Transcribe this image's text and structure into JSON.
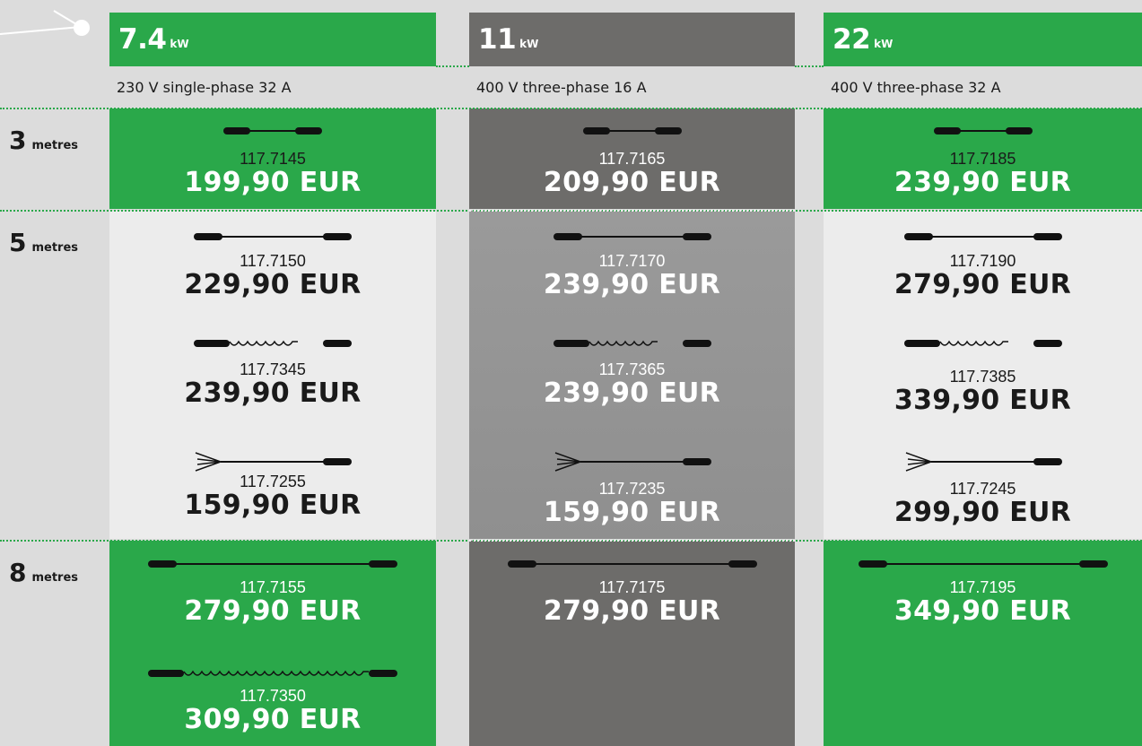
{
  "columns": [
    {
      "power": "7.4",
      "unit": "kW",
      "voltage": "230 V single-phase 32 A",
      "color": "#2aa84a"
    },
    {
      "power": "11",
      "unit": "kW",
      "voltage": "400 V three-phase 16 A",
      "color": "#6d6c6a"
    },
    {
      "power": "22",
      "unit": "kW",
      "voltage": "400 V three-phase 32 A",
      "color": "#2aa84a"
    }
  ],
  "rows": [
    {
      "length": "3",
      "unit": "metres"
    },
    {
      "length": "5",
      "unit": "metres"
    },
    {
      "length": "8",
      "unit": "metres"
    }
  ],
  "products": {
    "r3": [
      {
        "code": "117.7145",
        "price": "199,90 EUR"
      },
      {
        "code": "117.7165",
        "price": "209,90 EUR"
      },
      {
        "code": "117.7185",
        "price": "239,90 EUR"
      }
    ],
    "r5a": [
      {
        "code": "117.7150",
        "price": "229,90 EUR"
      },
      {
        "code": "117.7170",
        "price": "239,90 EUR"
      },
      {
        "code": "117.7190",
        "price": "279,90 EUR"
      }
    ],
    "r5b": [
      {
        "code": "117.7345",
        "price": "239,90 EUR"
      },
      {
        "code": "117.7365",
        "price": "239,90 EUR"
      },
      {
        "code": "117.7385",
        "price": "339,90 EUR"
      }
    ],
    "r5c": [
      {
        "code": "117.7255",
        "price": "159,90 EUR"
      },
      {
        "code": "117.7235",
        "price": "159,90 EUR"
      },
      {
        "code": "117.7245",
        "price": "299,90 EUR"
      }
    ],
    "r8a": [
      {
        "code": "117.7155",
        "price": "279,90 EUR"
      },
      {
        "code": "117.7175",
        "price": "279,90 EUR"
      },
      {
        "code": "117.7195",
        "price": "349,90 EUR"
      }
    ],
    "r8b": [
      {
        "code": "117.7350",
        "price": "309,90 EUR"
      }
    ]
  },
  "cable_icons": {
    "straight": "straight-cable-icon",
    "coiled": "coiled-cable-icon",
    "open_end": "open-end-cable-icon"
  }
}
